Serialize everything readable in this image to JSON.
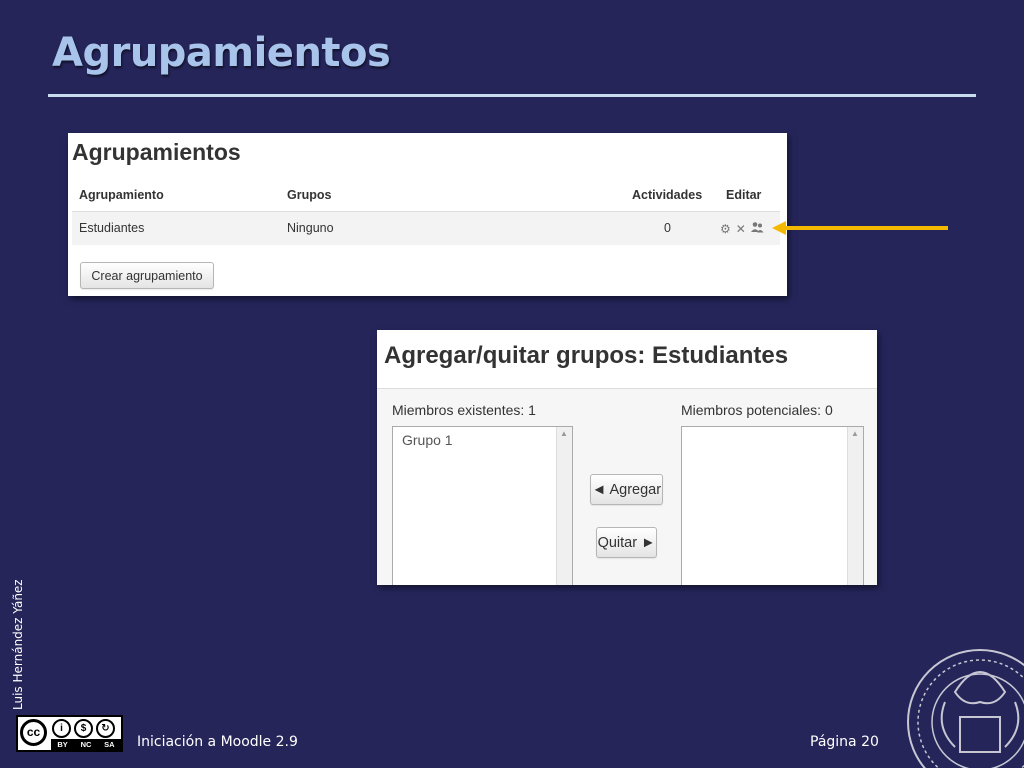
{
  "slide": {
    "title": "Agrupamientos",
    "author": "Luis Hernández Yáñez",
    "footer_left": "Iniciación a Moodle 2.9",
    "footer_right": "Página 20"
  },
  "license": {
    "cc_label": "cc",
    "tags": [
      "BY",
      "NC",
      "SA"
    ]
  },
  "groupings_panel": {
    "heading": "Agrupamientos",
    "columns": [
      "Agrupamiento",
      "Grupos",
      "Actividades",
      "Editar"
    ],
    "rows": [
      {
        "name": "Estudiantes",
        "groups": "Ninguno",
        "activities": "0"
      }
    ],
    "create_button": "Crear agrupamiento"
  },
  "add_remove_panel": {
    "heading": "Agregar/quitar grupos: Estudiantes",
    "existing_label": "Miembros existentes: 1",
    "potential_label": "Miembros potenciales: 0",
    "existing_items": [
      "Grupo 1"
    ],
    "add_button": "◄ Agregar",
    "remove_button": "Quitar ►"
  },
  "colors": {
    "background": "#25255a",
    "title": "#a9c4ea",
    "arrow": "#f5b800"
  },
  "icons": [
    "gear-icon",
    "delete-icon",
    "people-icon",
    "creative-commons-icon",
    "university-seal-icon"
  ]
}
